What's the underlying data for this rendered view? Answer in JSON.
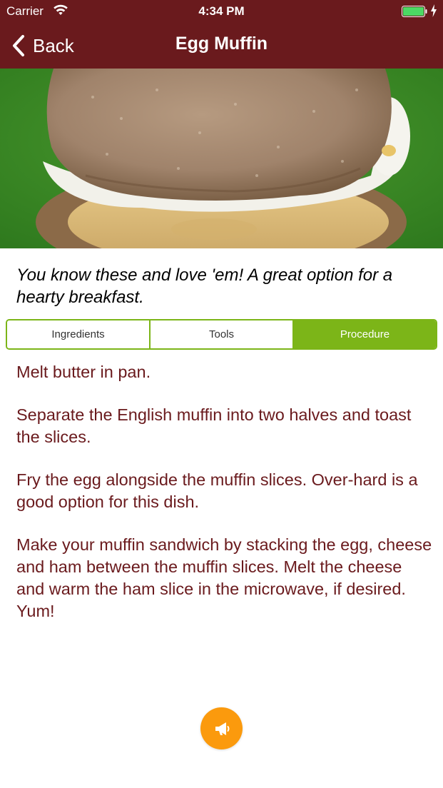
{
  "status_bar": {
    "carrier": "Carrier",
    "time": "4:34 PM",
    "battery_color": "#4cd964"
  },
  "nav": {
    "back_label": "Back",
    "title": "Egg Muffin",
    "background_color": "#6a1a1d"
  },
  "hero": {
    "icon": "egg-muffin-photo"
  },
  "description": "You know these and love 'em! A great option for a hearty breakfast.",
  "tabs": [
    {
      "label": "Ingredients",
      "active": false
    },
    {
      "label": "Tools",
      "active": false
    },
    {
      "label": "Procedure",
      "active": true
    }
  ],
  "tab_accent_color": "#7cb518",
  "procedure": [
    "Melt butter in pan.",
    "Separate the English muffin into two halves and toast the slices.",
    "Fry the egg alongside the muffin slices. Over-hard is a good option for this dish.",
    "Make your muffin sandwich by stacking the egg, cheese and ham between the muffin slices. Melt the cheese and warm the ham slice in the microwave, if desired. Yum!"
  ],
  "fab": {
    "icon": "megaphone-icon",
    "color": "#fb9a0d"
  }
}
